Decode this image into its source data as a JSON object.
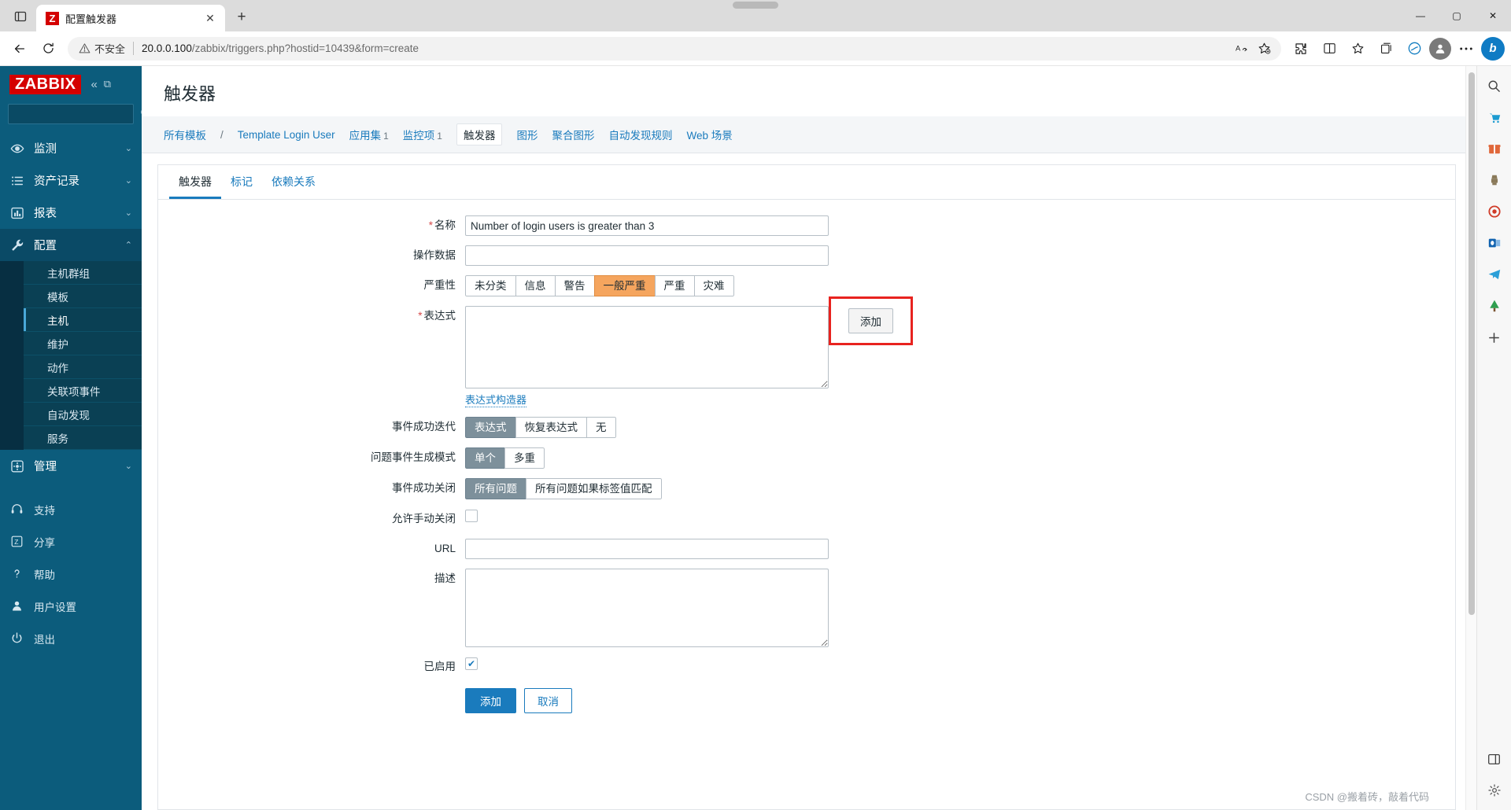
{
  "browser": {
    "tab": {
      "title": "配置触发器",
      "favicon_letter": "Z",
      "close_label": "✕"
    },
    "new_tab_label": "+",
    "window_controls": {
      "minimize": "—",
      "maximize": "▢",
      "close": "✕"
    },
    "nav": {
      "back_icon": "back-arrow-icon",
      "reload_icon": "reload-icon",
      "security_label": "不安全",
      "url": "20.0.0.100/zabbix/triggers.php?hostid=10439&form=create",
      "url_host": "20.0.0.100",
      "url_path": "/zabbix/triggers.php?hostid=10439&form=create",
      "read_aloud_label": "A",
      "favorite_label": "☆",
      "icons": [
        "extensions-icon",
        "split-screen-icon",
        "collections-icon",
        "favorites-icon",
        "browser-essentials-icon",
        "edge-copilot-icon",
        "profile-icon",
        "settings-more-icon",
        "bing-icon"
      ]
    }
  },
  "sidebar": {
    "brand": "ZABBIX",
    "collapse_label": "«",
    "expand_label": "⧉",
    "search_placeholder": "",
    "search_value": "",
    "items": [
      {
        "label": "监测",
        "icon": "eye-icon",
        "chevron": "⌄",
        "active": false
      },
      {
        "label": "资产记录",
        "icon": "list-icon",
        "chevron": "⌄",
        "active": false
      },
      {
        "label": "报表",
        "icon": "chart-icon",
        "chevron": "⌄",
        "active": false
      },
      {
        "label": "配置",
        "icon": "wrench-icon",
        "chevron": "⌃",
        "active": true
      }
    ],
    "sub_items": [
      {
        "label": "主机群组",
        "current": false
      },
      {
        "label": "模板",
        "current": false
      },
      {
        "label": "主机",
        "current": true
      },
      {
        "label": "维护",
        "current": false
      },
      {
        "label": "动作",
        "current": false
      },
      {
        "label": "关联项事件",
        "current": false
      },
      {
        "label": "自动发现",
        "current": false
      },
      {
        "label": "服务",
        "current": false
      }
    ],
    "admin": {
      "label": "管理",
      "icon": "gear-icon",
      "chevron": "⌄"
    },
    "bottom_items": [
      {
        "label": "支持",
        "icon": "headset-icon"
      },
      {
        "label": "分享",
        "icon": "share-icon"
      },
      {
        "label": "帮助",
        "icon": "question-icon"
      },
      {
        "label": "用户设置",
        "icon": "user-icon"
      },
      {
        "label": "退出",
        "icon": "power-icon"
      }
    ]
  },
  "page": {
    "title": "触发器",
    "breadcrumb": {
      "all_templates": "所有模板",
      "separator": "/",
      "template_name": "Template Login User",
      "links": [
        {
          "label": "应用集",
          "count": "1",
          "current": false
        },
        {
          "label": "监控项",
          "count": "1",
          "current": false
        },
        {
          "label": "触发器",
          "count": "",
          "current": true
        },
        {
          "label": "图形",
          "count": "",
          "current": false
        },
        {
          "label": "聚合图形",
          "count": "",
          "current": false
        },
        {
          "label": "自动发现规则",
          "count": "",
          "current": false
        },
        {
          "label": "Web 场景",
          "count": "",
          "current": false
        }
      ]
    },
    "tabs": [
      {
        "label": "触发器",
        "active": true
      },
      {
        "label": "标记",
        "active": false
      },
      {
        "label": "依赖关系",
        "active": false
      }
    ],
    "form": {
      "name": {
        "label": "名称",
        "required": true,
        "value": "Number of login users is greater than 3",
        "placeholder": ""
      },
      "event_name": {
        "label": "操作数据",
        "required": false,
        "value": "",
        "placeholder": ""
      },
      "severity": {
        "label": "严重性",
        "options": [
          "未分类",
          "信息",
          "警告",
          "一般严重",
          "严重",
          "灾难"
        ],
        "selected": "一般严重"
      },
      "expression": {
        "label": "表达式",
        "required": true,
        "value": "",
        "placeholder": "",
        "add_button": "添加",
        "constructor_link": "表达式构造器"
      },
      "ok_event_generation": {
        "label": "事件成功迭代",
        "options": [
          "表达式",
          "恢复表达式",
          "无"
        ],
        "selected": "表达式"
      },
      "problem_event_mode": {
        "label": "问题事件生成模式",
        "options": [
          "单个",
          "多重"
        ],
        "selected": "单个"
      },
      "ok_event_closes": {
        "label": "事件成功关闭",
        "options": [
          "所有问题",
          "所有问题如果标签值匹配"
        ],
        "selected": "所有问题"
      },
      "manual_close": {
        "label": "允许手动关闭",
        "checked": false,
        "check_glyph": "✔"
      },
      "url": {
        "label": "URL",
        "value": "",
        "placeholder": ""
      },
      "description": {
        "label": "描述",
        "value": "",
        "placeholder": ""
      },
      "enabled": {
        "label": "已启用",
        "checked": true,
        "check_glyph": "✔"
      },
      "actions": {
        "submit": "添加",
        "cancel": "取消"
      }
    }
  },
  "watermark": "CSDN @搬着砖，敲着代码"
}
